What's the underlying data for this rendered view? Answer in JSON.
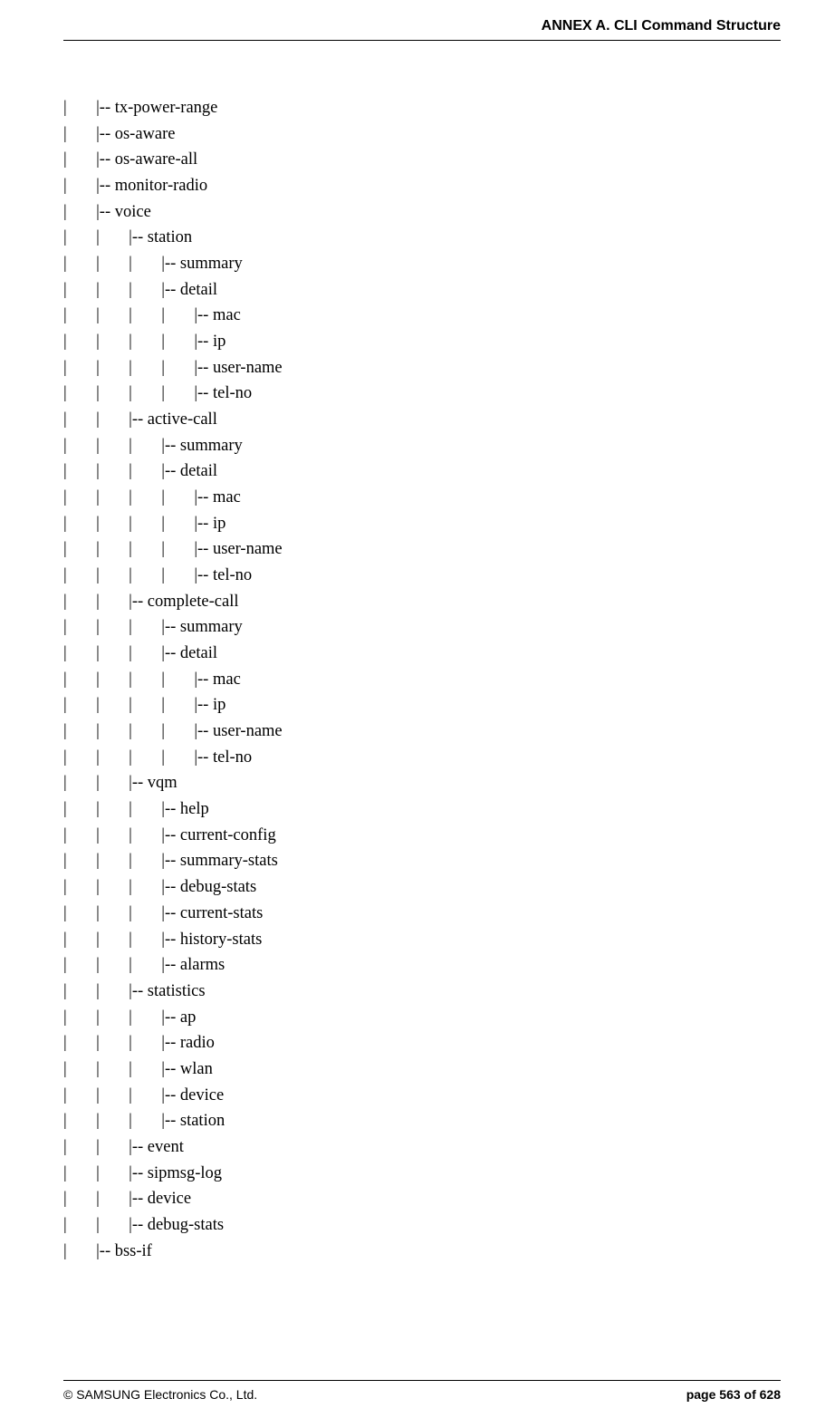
{
  "header": {
    "title": "ANNEX A. CLI Command Structure"
  },
  "tree": {
    "text": "|       |-- tx-power-range\n|       |-- os-aware\n|       |-- os-aware-all\n|       |-- monitor-radio\n|       |-- voice\n|       |       |-- station\n|       |       |       |-- summary\n|       |       |       |-- detail\n|       |       |       |       |-- mac\n|       |       |       |       |-- ip\n|       |       |       |       |-- user-name\n|       |       |       |       |-- tel-no\n|       |       |-- active-call\n|       |       |       |-- summary\n|       |       |       |-- detail\n|       |       |       |       |-- mac\n|       |       |       |       |-- ip\n|       |       |       |       |-- user-name\n|       |       |       |       |-- tel-no\n|       |       |-- complete-call\n|       |       |       |-- summary\n|       |       |       |-- detail\n|       |       |       |       |-- mac\n|       |       |       |       |-- ip\n|       |       |       |       |-- user-name\n|       |       |       |       |-- tel-no\n|       |       |-- vqm\n|       |       |       |-- help\n|       |       |       |-- current-config\n|       |       |       |-- summary-stats\n|       |       |       |-- debug-stats\n|       |       |       |-- current-stats\n|       |       |       |-- history-stats\n|       |       |       |-- alarms\n|       |       |-- statistics\n|       |       |       |-- ap\n|       |       |       |-- radio\n|       |       |       |-- wlan\n|       |       |       |-- device\n|       |       |       |-- station\n|       |       |-- event\n|       |       |-- sipmsg-log\n|       |       |-- device\n|       |       |-- debug-stats\n|       |-- bss-if"
  },
  "footer": {
    "left": "© SAMSUNG Electronics Co., Ltd.",
    "right": "page 563 of 628"
  }
}
